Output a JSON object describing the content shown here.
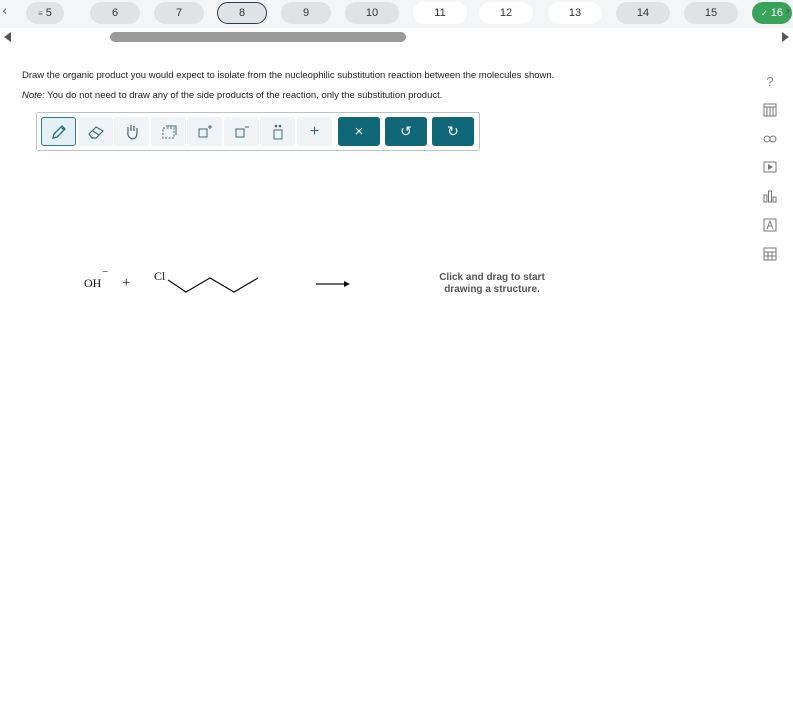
{
  "nav": {
    "prev_arrow": "‹",
    "next_arrow": "›",
    "questions": [
      {
        "label": "5",
        "state": "grey",
        "prefix": "≡"
      },
      {
        "label": "6",
        "state": "grey"
      },
      {
        "label": "7",
        "state": "grey"
      },
      {
        "label": "8",
        "state": "current"
      },
      {
        "label": "9",
        "state": "grey"
      },
      {
        "label": "10",
        "state": "grey"
      },
      {
        "label": "11",
        "state": "white"
      },
      {
        "label": "12",
        "state": "white"
      },
      {
        "label": "13",
        "state": "white"
      },
      {
        "label": "14",
        "state": "grey"
      },
      {
        "label": "15",
        "state": "grey"
      },
      {
        "label": "16",
        "state": "done",
        "prefix": "✓"
      }
    ]
  },
  "instructions": {
    "line1": "Draw the organic product you would expect to isolate from the nucleophilic substitution reaction between the molecules shown.",
    "note_label": "Note:",
    "note_text": " You do not need to draw any of the side products of the reaction, only the substitution product."
  },
  "toolbar": {
    "tools": [
      "pencil-icon",
      "eraser-icon",
      "hand-icon",
      "select-box-icon",
      "add-charge-icon",
      "remove-charge-icon",
      "lone-pair-icon",
      "add-icon",
      "clear-icon",
      "undo-icon",
      "redo-icon"
    ],
    "plus": "+",
    "clear": "×",
    "undo": "↺",
    "redo": "↻"
  },
  "side_tools": {
    "help": "?",
    "icons": [
      "help-icon",
      "periodic-table-icon",
      "link-icon",
      "video-icon",
      "chart-icon",
      "reference-icon",
      "calculator-icon"
    ]
  },
  "reaction": {
    "reagent1": "OH",
    "reagent1_charge": "−",
    "plus": "+",
    "chlorine": "Cl"
  },
  "canvas": {
    "hint_line1": "Click and drag to start",
    "hint_line2": "drawing a structure."
  }
}
